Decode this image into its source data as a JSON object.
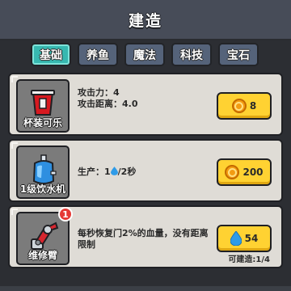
{
  "header": {
    "title": "建造"
  },
  "tabs": [
    {
      "label": "基础",
      "active": true
    },
    {
      "label": "养鱼",
      "active": false
    },
    {
      "label": "魔法",
      "active": false
    },
    {
      "label": "科技",
      "active": false
    },
    {
      "label": "宝石",
      "active": false
    }
  ],
  "items": [
    {
      "name": "杯装可乐",
      "desc_line1": "攻击力：4",
      "desc_line2": "攻击距离：4.0",
      "cost": "8",
      "currency_icon": "coin-icon"
    },
    {
      "name": "1级饮水机",
      "desc_prefix": "生产：1",
      "desc_suffix": "/2秒",
      "cost": "200",
      "currency_icon": "coin-icon"
    },
    {
      "name": "维修臂",
      "badge": "1",
      "desc": "每秒恢复门2%的血量，没有距离限制",
      "cost": "54",
      "currency_icon": "water-drop-icon",
      "build_count": "可建造:1/4"
    }
  ],
  "colors": {
    "active_tab": "#37b8b0",
    "tab": "#55637a",
    "button": "#ffd232",
    "card": "#dfdcd6",
    "badge": "#e53935"
  }
}
